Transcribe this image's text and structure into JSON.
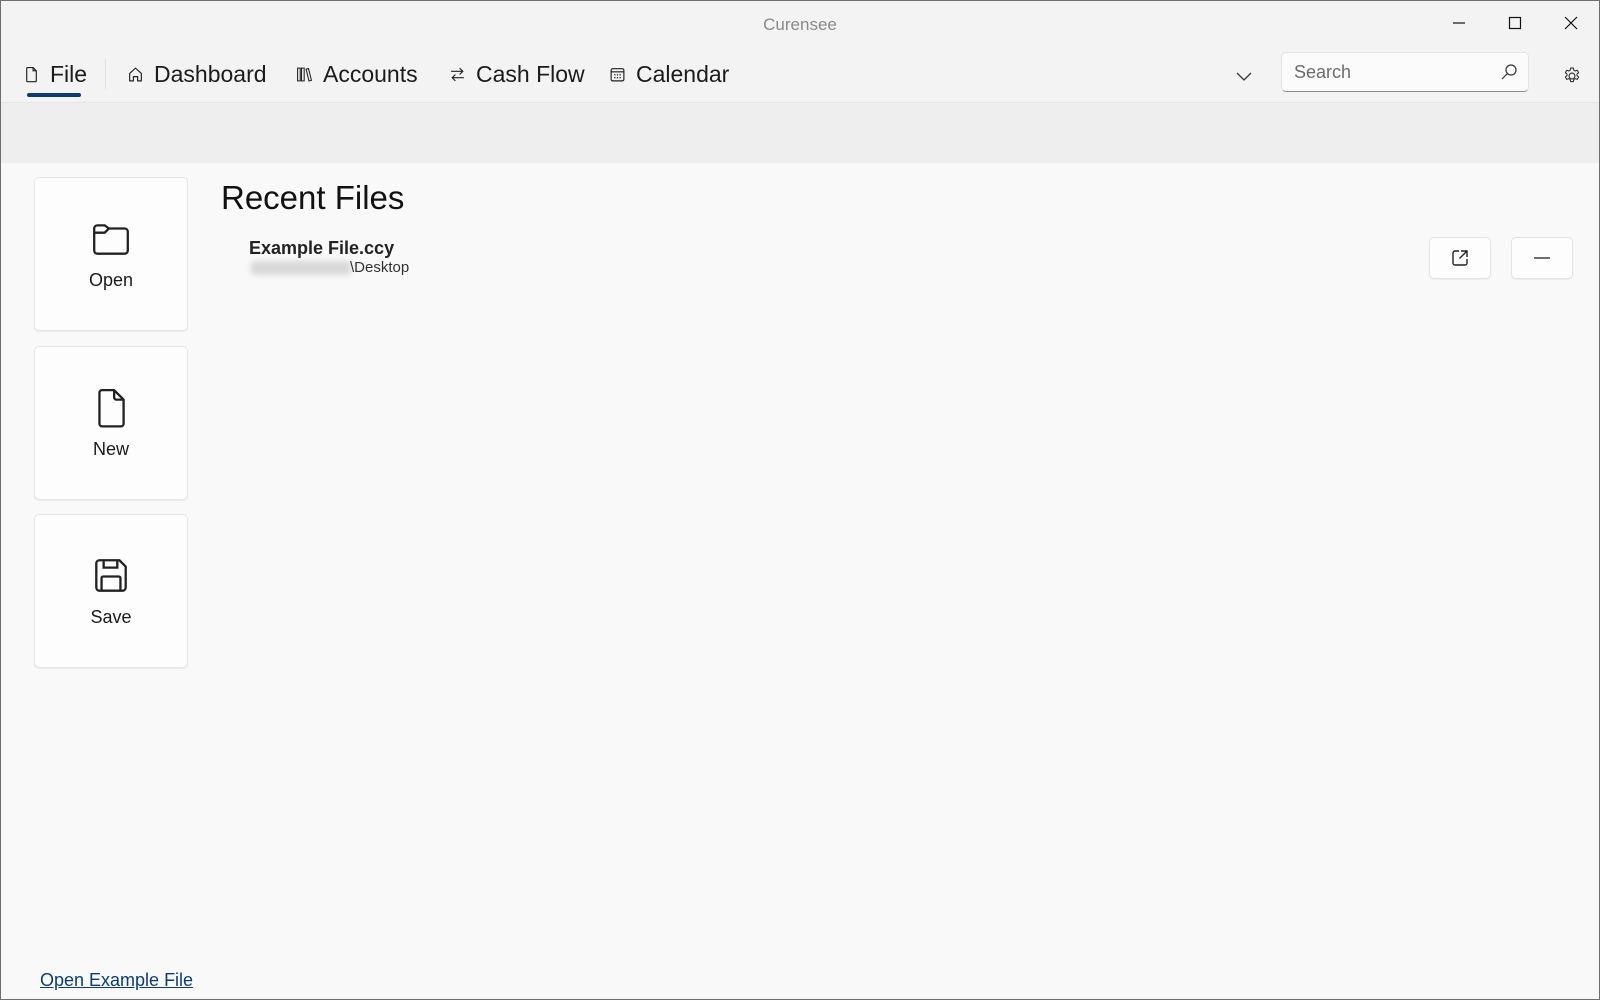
{
  "app": {
    "title": "Curensee"
  },
  "window_controls": {
    "minimize": "minimize",
    "maximize": "maximize",
    "close": "close"
  },
  "nav": {
    "items": [
      {
        "label": "File",
        "icon": "document-icon",
        "selected": true
      },
      {
        "label": "Dashboard",
        "icon": "home-icon",
        "selected": false
      },
      {
        "label": "Accounts",
        "icon": "library-icon",
        "selected": false
      },
      {
        "label": "Cash Flow",
        "icon": "arrows-swap-icon",
        "selected": false
      },
      {
        "label": "Calendar",
        "icon": "calendar-icon",
        "selected": false
      }
    ],
    "accent_color": "#0b3d74"
  },
  "search": {
    "placeholder": "Search",
    "value": ""
  },
  "file_actions": [
    {
      "label": "Open",
      "icon": "folder-icon"
    },
    {
      "label": "New",
      "icon": "new-document-icon"
    },
    {
      "label": "Save",
      "icon": "save-icon"
    }
  ],
  "recent_files": {
    "title": "Recent Files",
    "items": [
      {
        "name": "Example File.ccy",
        "path_suffix": "\\Desktop"
      }
    ]
  },
  "footer": {
    "open_example_label": "Open Example File"
  }
}
